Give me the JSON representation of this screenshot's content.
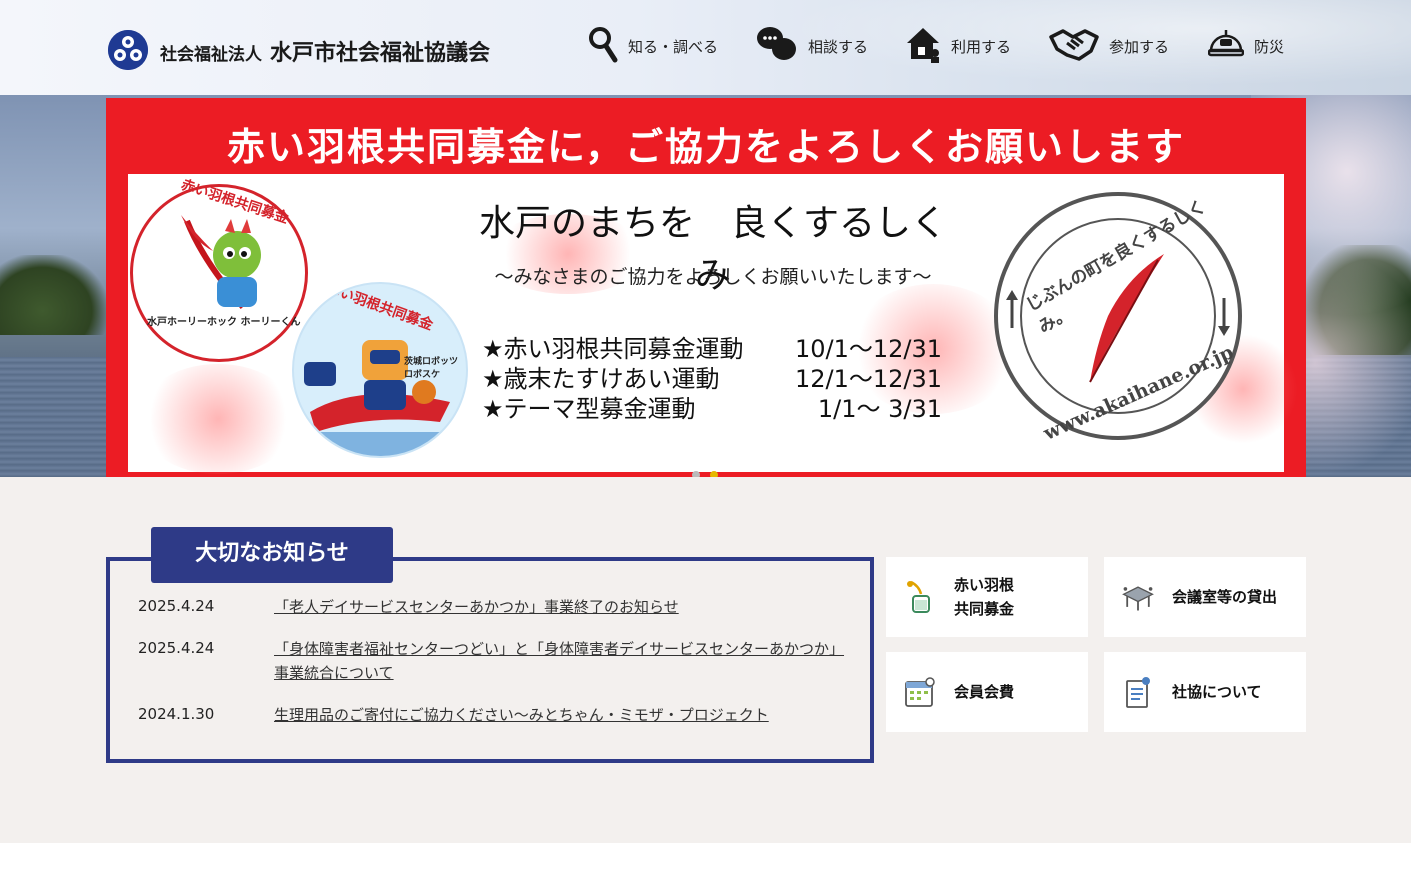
{
  "header": {
    "logo_small": "社会福祉法人",
    "logo_big": "水戸市社会福祉協議会",
    "nav": [
      {
        "label": "知る・調べる",
        "icon": "search-icon"
      },
      {
        "label": "相談する",
        "icon": "chat-icon"
      },
      {
        "label": "利用する",
        "icon": "house-icon"
      },
      {
        "label": "参加する",
        "icon": "handshake-icon"
      },
      {
        "label": "防災",
        "icon": "helmet-icon"
      }
    ]
  },
  "banner": {
    "headline": "赤い羽根共同募金に，ご協力をよろしくお願いします",
    "subtitle": "水戸のまちを　良くするしくみ",
    "subtitle2": "～みなさまのご協力をよろしくお願いいたします～",
    "campaigns": [
      {
        "name": "★赤い羽根共同募金運動",
        "period": "10/1～12/31"
      },
      {
        "name": "★歳末たすけあい運動",
        "period": "12/1～12/31"
      },
      {
        "name": "★テーマ型募金運動",
        "period": "1/1～ 3/31"
      }
    ],
    "mascot1_ring": "赤い羽根共同募金",
    "mascot1_name": "水戸ホーリーホック ホーリーくん",
    "mascot2_ring": "赤い羽根共同募金",
    "mascot2_name": "茨城ロボッツ ロボスケ",
    "stamp_top": "じぶんの町を良くするしくみ。",
    "stamp_bottom": "www.akaihane.or.jp"
  },
  "slider": {
    "count": 2,
    "active": 2
  },
  "notice": {
    "title": "大切なお知らせ",
    "items": [
      {
        "date": "2025.4.24",
        "text": "「老人デイサービスセンターあかつか」事業終了のお知らせ"
      },
      {
        "date": "2025.4.24",
        "text": "「身体障害者福祉センターつどい」と「身体障害者デイサービスセンターあかつか」事業統合について"
      },
      {
        "date": "2024.1.30",
        "text": "生理用品のご寄付にご協力ください～みとちゃん・ミモザ・プロジェクト"
      }
    ]
  },
  "cards": [
    {
      "label_line1": "赤い羽根",
      "label_line2": "共同募金",
      "icon": "red-feather-fundraising-icon"
    },
    {
      "label_line1": "会議室等の貸出",
      "label_line2": "",
      "icon": "meeting-room-icon"
    },
    {
      "label_line1": "会員会費",
      "label_line2": "",
      "icon": "calendar-icon"
    },
    {
      "label_line1": "社協について",
      "label_line2": "",
      "icon": "document-icon"
    }
  ],
  "colors": {
    "brand_navy": "#2e3a87",
    "banner_red": "#ec1c24",
    "content_bg": "#f3f0ee",
    "slider_active": "#e6b800"
  }
}
